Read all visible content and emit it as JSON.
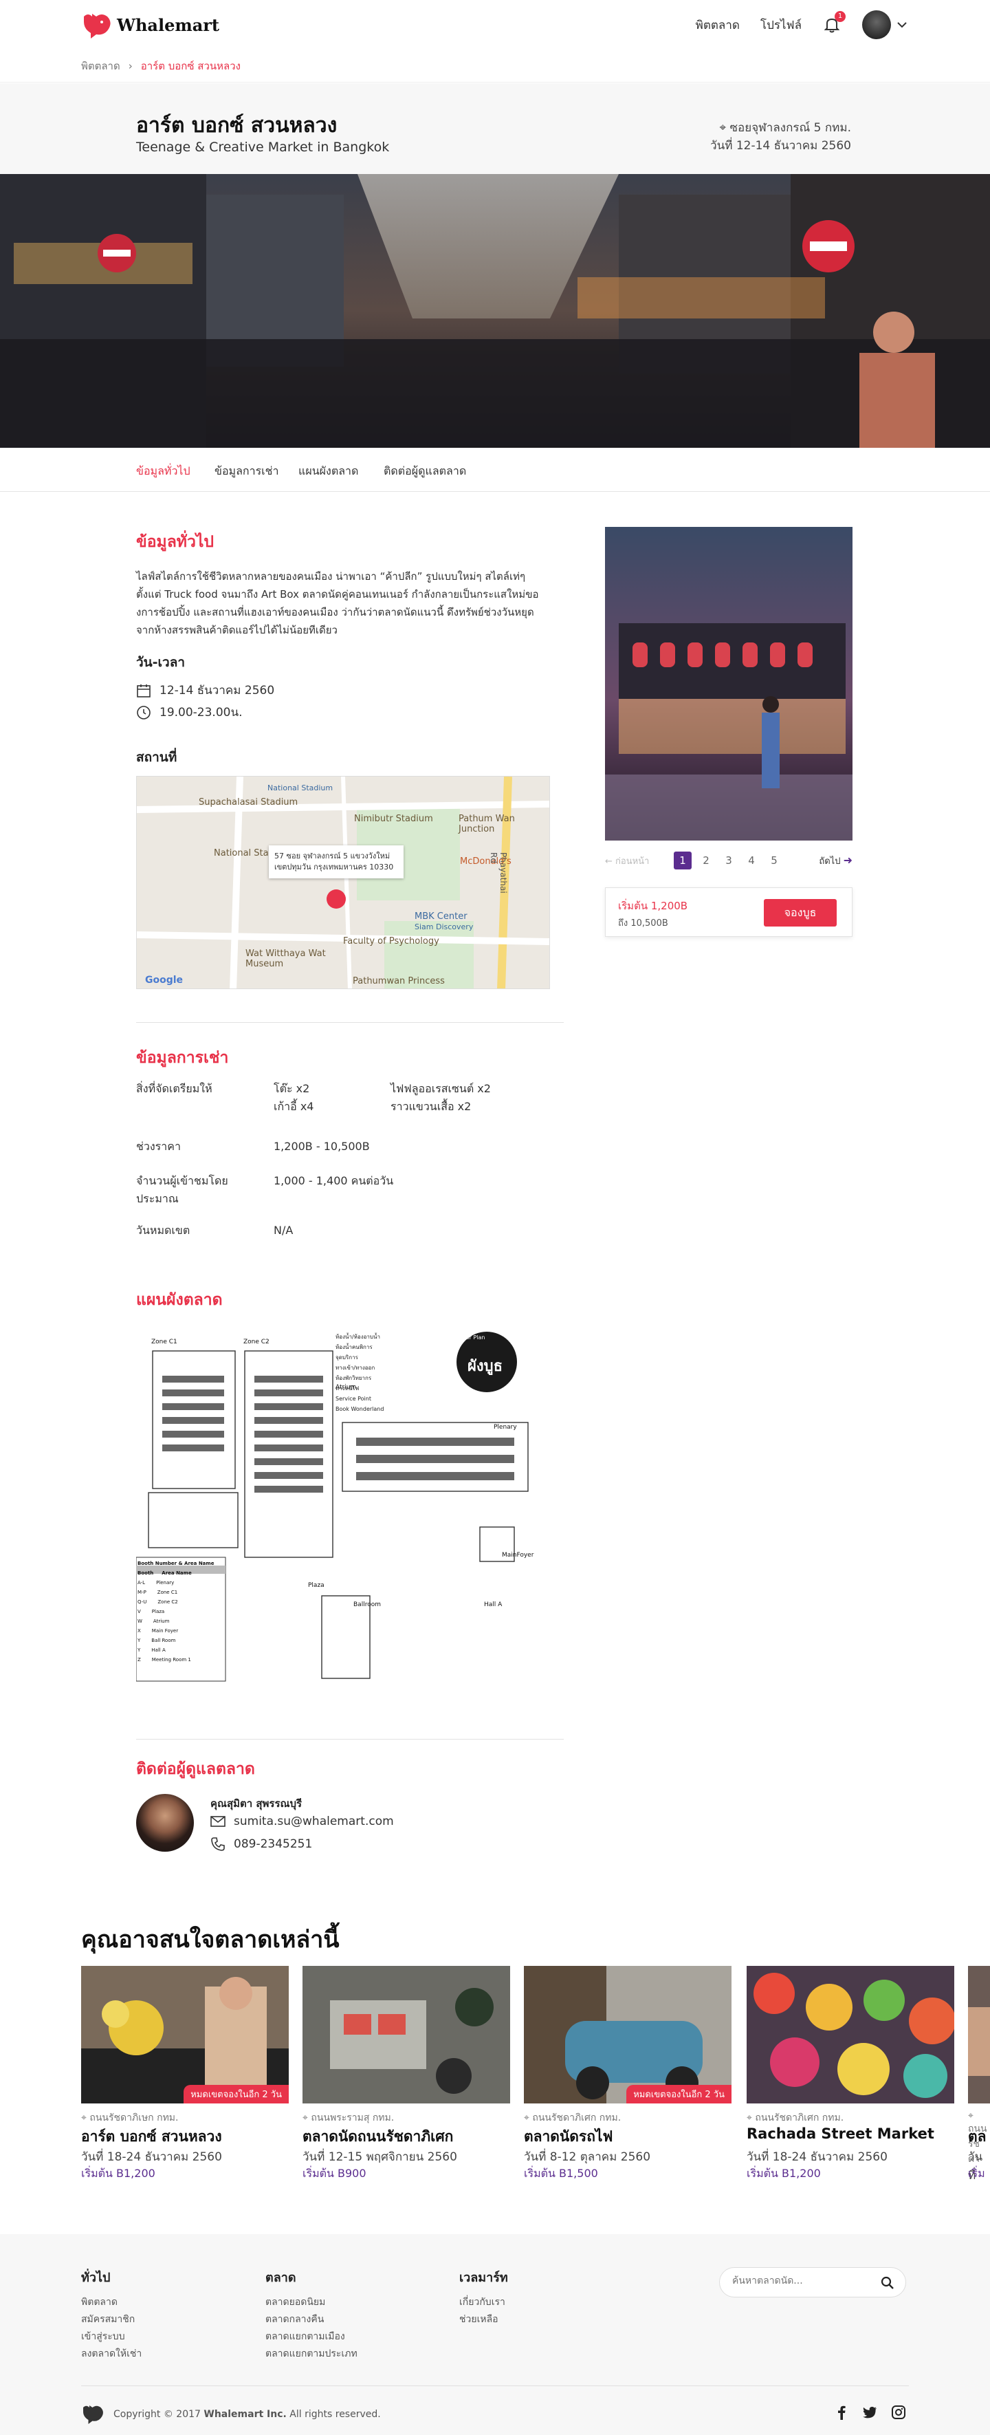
{
  "header": {
    "brand": "Whalemart",
    "nav": [
      "พิตตลาด",
      "โปรไฟล์"
    ],
    "notification_count": "1",
    "icons": [
      "whale-logo-icon",
      "bell-icon",
      "chevron-down-icon"
    ]
  },
  "breadcrumb": {
    "home": "พิตตลาด",
    "current": "อาร์ต บอกซ์ สวนหลวง"
  },
  "market": {
    "title": "อาร์ต บอกซ์ สวนหลวง",
    "subtitle": "Teenage & Creative Market in Bangkok",
    "location": "ซอยจุฬาลงกรณ์ 5 กทม.",
    "date_line": "วันที่ 12-14 ธันวาคม 2560"
  },
  "tabs": [
    "ข้อมูลทั่วไป",
    "ข้อมูลการเช่า",
    "แผนผังตลาด",
    "ติดต่อผู้ดูแลตลาด"
  ],
  "general": {
    "heading": "ข้อมูลทั่วไป",
    "description": "ไลฟ์สไตล์การใช้ชีวิตหลากหลายของคนเมือง น่าพาเอา “ค้าปลีก” รูปแบบใหม่ๆ สไตล์เท่ๆ ตั้งแต่ Truck food จนมาถึง Art Box ตลาดนัดคู่คอนเทนเนอร์ กำลังกลายเป็นกระแสใหม่ของการช้อปปิ้ง และสถานที่แฮงเอาท์ของคนเมือง ว่ากันว่าตลาดนัดแนวนี้ ดึงทรัพย์ช่วงวันหยุดจากห้างสรรพสินค้าติดแอร์ไปได้ไม่น้อยทีเดียว",
    "datetime_heading": "วัน-เวลา",
    "dates": "12-14 ธันวาคม 2560",
    "hours": "19.00-23.00น.",
    "place_heading": "สถานที่",
    "map_address": "57 ซอย จุฬาลงกรณ์ 5 แขวงวังใหม่ เขตปทุมวัน กรุงเทพมหานคร 10330",
    "map_labels": [
      "National Stadium",
      "Supachalasai Stadium",
      "Nimibutr Stadium",
      "Pathum Wan Junction",
      "National Stadium",
      "McDonald's",
      "Phayathai Rd",
      "MBK Center",
      "Siam Discovery",
      "Faculty of Psychology",
      "Wat Witthaya Wat Museum",
      "Pathumwan Princess",
      "Google"
    ]
  },
  "rental": {
    "heading": "ข้อมูลการเช่า",
    "provided_label": "สิ่งที่จัดเตรียมให้",
    "provided_col1": [
      "โต๊ะ x2",
      "เก้าอี้ x4"
    ],
    "provided_col2": [
      "ไฟฟลูออเรสเซนต์ x2",
      "ราวแขวนเสื้อ x2"
    ],
    "price_label": "ช่วงราคา",
    "price_value": "1,200B - 10,500B",
    "visitors_label": "จำนวนผู้เข้าชมโดยประมาณ",
    "visitors_value": "1,000 - 1,400 คนต่อวัน",
    "deadline_label": "วันหมดเขต",
    "deadline_value": "N/A"
  },
  "floorplan": {
    "heading": "แผนผังตลาด",
    "badge_top": "Floor Plan",
    "badge_main": "ผังบูธ",
    "zones": [
      "Zone C1",
      "Zone C2",
      "Atrium",
      "Plenary",
      "MainFoyer",
      "Plaza",
      "Ballroom",
      "Hall A"
    ],
    "legend": [
      "ห้องน้ำ/ห้องอาบน้ำ",
      "ห้องน้ำคนพิการ",
      "จุดบริการ",
      "ทางเข้า/ทางออก",
      "ห้องพักวิทยากร",
      "ทางหนีไฟ",
      "Service Point",
      "Book Wonderland"
    ],
    "table_headers": [
      "Booth",
      "Area Name"
    ],
    "table_rows": [
      [
        "A-L",
        "Plenary"
      ],
      [
        "M-P",
        "Zone C1"
      ],
      [
        "Q-U",
        "Zone C2"
      ],
      [
        "V",
        "Plaza"
      ],
      [
        "W",
        "Atrium"
      ],
      [
        "X",
        "Main Foyer"
      ],
      [
        "Y",
        "Ball Room"
      ],
      [
        "Y",
        "Hall A"
      ],
      [
        "Z",
        "Meeting Room 1"
      ]
    ],
    "table_title": "Booth Number & Area Name"
  },
  "contact": {
    "heading": "ติดต่อผู้ดูแลตลาด",
    "name": "คุณสุมิตา สุพรรณบุรี",
    "email": "sumita.su@whalemart.com",
    "phone": "089-2345251"
  },
  "sidebar": {
    "pager_prev": "ก่อนหน้า",
    "pager_next": "ถัดไป",
    "pages": [
      "1",
      "2",
      "3",
      "4",
      "5"
    ],
    "active_page": "1",
    "price_from": "เริ่มต้น  1,200B",
    "price_to": "ถึง 10,500B",
    "book_button": "จองบูธ"
  },
  "recommend": {
    "heading": "คุณอาจสนใจตลาดเหล่านี้",
    "cards": [
      {
        "location": "ถนนรัชดาภิเษก กทม.",
        "name": "อาร์ต บอกซ์ สวนหลวง",
        "date": "วันที่ 18-24 ธันวาคม 2560",
        "price": "เริ่มต้น B1,200",
        "tag": "หมดเขตจองในอีก 2 วัน"
      },
      {
        "location": "ถนนพระรามสุ กทม.",
        "name": "ตลาดนัดถนนรัชดาภิเศก",
        "date": "วันที่ 12-15 พฤศจิกายน 2560",
        "price": "เริ่มต้น B900",
        "tag": ""
      },
      {
        "location": "ถนนรัชดาภิเศก กทม.",
        "name": "ตลาดนัดรถไฟ",
        "date": "วันที่ 8-12 ตุลาคม 2560",
        "price": "เริ่มต้น B1,500",
        "tag": "หมดเขตจองในอีก 2 วัน"
      },
      {
        "location": "ถนนรัชดาภิเศก กทม.",
        "name": "Rachada Street Market",
        "date": "วันที่ 18-24 ธันวาคม 2560",
        "price": "เริ่มต้น B1,200",
        "tag": ""
      },
      {
        "location": "ถนนรัชดา",
        "name": "ตล",
        "date": "วันที่",
        "price": "เริ่มต",
        "tag": ""
      }
    ]
  },
  "footer": {
    "col1_heading": "ทั่วไป",
    "col1_items": [
      "พิตตลาด",
      "สมัครสมาชิก",
      "เข้าสู่ระบบ",
      "ลงตลาดให้เช่า"
    ],
    "col2_heading": "ตลาด",
    "col2_items": [
      "ตลาดยอดนิยม",
      "ตลาดกลางคืน",
      "ตลาดแยกตามเมือง",
      "ตลาดแยกตามประเภท"
    ],
    "col3_heading": "เวลมาร์ท",
    "col3_items": [
      "เกี่ยวกับเรา",
      "ช่วยเหลือ"
    ],
    "search_placeholder": "ค้นหาตลาดนัด...",
    "copyright_prefix": "Copyright © 2017 ",
    "copyright_brand": "Whalemart Inc.",
    "copyright_suffix": " All rights reserved.",
    "social": [
      "facebook-icon",
      "twitter-icon",
      "instagram-icon"
    ]
  },
  "colors": {
    "accent": "#e8334a",
    "purple": "#5b2d8f",
    "footer_bg": "#f7f7f7"
  }
}
